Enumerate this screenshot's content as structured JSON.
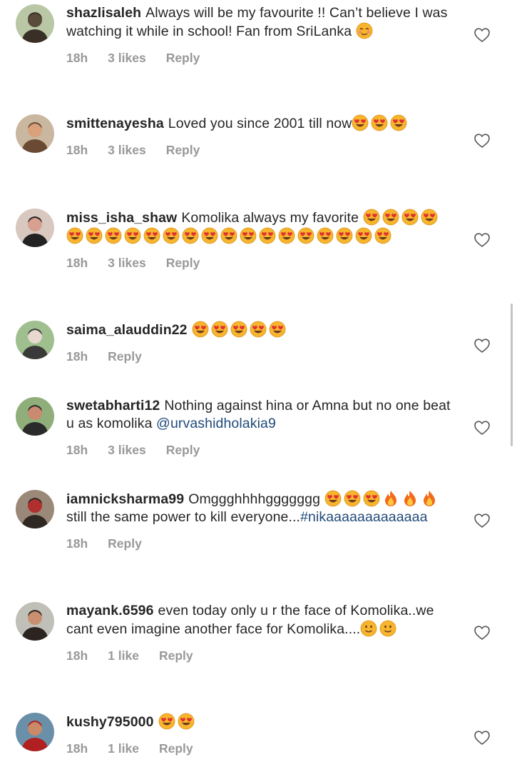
{
  "comments": [
    {
      "avatar": "person-avatar",
      "username": "shazlisaleh",
      "segments": [
        {
          "type": "text",
          "value": "Always will be my favourite !! Can’t believe I was watching it while in school! Fan from SriLanka "
        },
        {
          "type": "emoji",
          "icon": "smiling-face-emoji",
          "count": 1
        }
      ],
      "time": "18h",
      "likes": "3 likes",
      "reply": "Reply"
    },
    {
      "avatar": "person-avatar",
      "username": "smittenayesha",
      "segments": [
        {
          "type": "text",
          "value": "Loved you since 2001 till now"
        },
        {
          "type": "emoji",
          "icon": "heart-eyes-emoji",
          "count": 3
        }
      ],
      "time": "18h",
      "likes": "3 likes",
      "reply": "Reply"
    },
    {
      "avatar": "person-avatar",
      "username": "miss_isha_shaw",
      "segments": [
        {
          "type": "text",
          "value": "Komolika always my favorite "
        },
        {
          "type": "emoji",
          "icon": "heart-eyes-emoji",
          "count": 21
        }
      ],
      "time": "18h",
      "likes": "3 likes",
      "reply": "Reply"
    },
    {
      "avatar": "person-avatar",
      "username": "saima_alauddin22",
      "segments": [
        {
          "type": "emoji",
          "icon": "heart-eyes-emoji",
          "count": 5
        }
      ],
      "time": "18h",
      "likes": "",
      "reply": "Reply"
    },
    {
      "avatar": "person-avatar",
      "username": "swetabharti12",
      "segments": [
        {
          "type": "text",
          "value": "Nothing against hina or Amna but no one beat u as komolika "
        },
        {
          "type": "mention",
          "value": "@urvashidholakia9"
        }
      ],
      "time": "18h",
      "likes": "3 likes",
      "reply": "Reply"
    },
    {
      "avatar": "person-avatar",
      "username": "iamnicksharma99",
      "segments": [
        {
          "type": "text",
          "value": "Omggghhhhggggggg "
        },
        {
          "type": "emoji",
          "icon": "heart-eyes-emoji",
          "count": 3
        },
        {
          "type": "emoji",
          "icon": "fire-emoji",
          "count": 3
        },
        {
          "type": "text",
          "value": "still the same power to kill everyone..."
        },
        {
          "type": "hashtag",
          "value": "#nikaaaaaaaaaaaaa"
        }
      ],
      "time": "18h",
      "likes": "",
      "reply": "Reply"
    },
    {
      "avatar": "person-avatar",
      "username": "mayank.6596",
      "segments": [
        {
          "type": "text",
          "value": "even today only u r the face of Komolika..we cant even imagine another face for Komolika...."
        },
        {
          "type": "emoji",
          "icon": "slightly-smiling-emoji",
          "count": 2
        }
      ],
      "time": "18h",
      "likes": "1 like",
      "reply": "Reply"
    },
    {
      "avatar": "person-avatar",
      "username": "kushy795000",
      "segments": [
        {
          "type": "emoji",
          "icon": "heart-eyes-emoji",
          "count": 2
        }
      ],
      "time": "18h",
      "likes": "1 like",
      "reply": "Reply"
    }
  ],
  "colors": {
    "text": "#262626",
    "meta": "#999999",
    "link": "#1f4a7a",
    "emoji_face": "#f7b52e",
    "heart": "#e0302f"
  }
}
